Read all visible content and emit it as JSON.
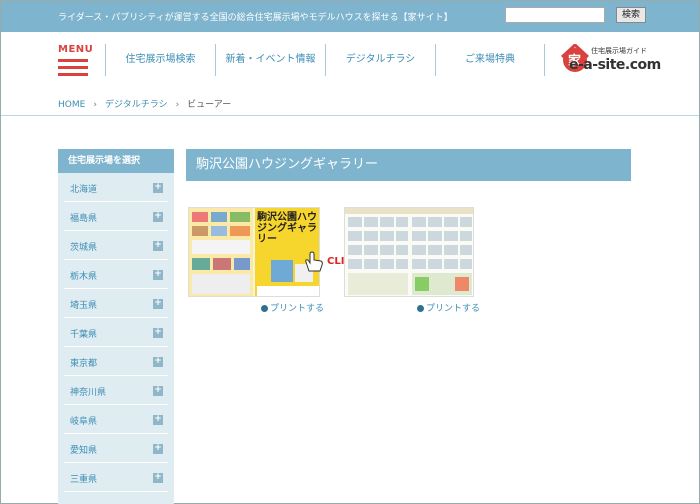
{
  "topbar": {
    "tagline": "ライダース・パブリシティが運営する全国の総合住宅展示場やモデルハウスを探せる【家サイト】",
    "search_placeholder": "",
    "search_button": "検索"
  },
  "header": {
    "menu_label": "MENU",
    "nav": [
      "住宅展示場検索",
      "新着・イベント情報",
      "デジタルチラシ",
      "ご来場特典"
    ],
    "logo_kanji": "家",
    "logo_sub": "住宅展示場ガイド",
    "logo_main": "e-a-site.com"
  },
  "breadcrumb": [
    "HOME",
    "デジタルチラシ",
    "ビューアー"
  ],
  "sidebar": {
    "title": "住宅展示場を選択",
    "items": [
      "北海道",
      "福島県",
      "茨城県",
      "栃木県",
      "埼玉県",
      "千葉県",
      "東京都",
      "神奈川県",
      "岐阜県",
      "愛知県",
      "三重県"
    ]
  },
  "main": {
    "title": "駒沢公園ハウジングギャラリー",
    "flyer1_title": "駒沢公園ハウジングギャラリー",
    "click_label": "CLICK!",
    "print_label": "プリントする"
  },
  "colors": {
    "accent_blue": "#7eb4cd",
    "link_blue": "#3d8db4",
    "menu_red": "#d9423e",
    "sidebar_bg": "#dfecf1"
  }
}
